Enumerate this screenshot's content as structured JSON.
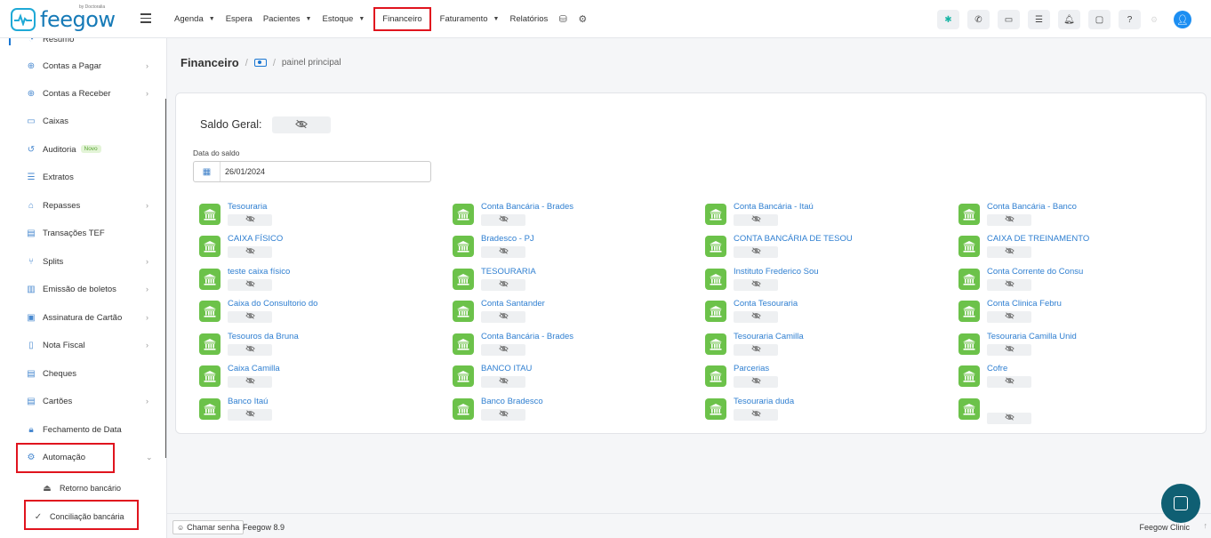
{
  "app": {
    "logo_text": "feegow",
    "logo_by": "by Doctoralia"
  },
  "nav": {
    "items": [
      {
        "label": "Agenda",
        "has_caret": true
      },
      {
        "label": "Espera",
        "has_caret": false
      },
      {
        "label": "Pacientes",
        "has_caret": true
      },
      {
        "label": "Estoque",
        "has_caret": true
      },
      {
        "label": "Financeiro",
        "has_caret": false,
        "highlighted": true
      },
      {
        "label": "Faturamento",
        "has_caret": true
      },
      {
        "label": "Relatórios",
        "has_caret": false
      }
    ],
    "extra_icons": [
      "database-icon",
      "gear-icon"
    ],
    "right_icons": [
      "star-icon",
      "phone-icon",
      "inbox-icon",
      "list-icon",
      "bell-icon",
      "chat-icon",
      "help-icon"
    ]
  },
  "sidebar": {
    "items": [
      {
        "label": "Resumo",
        "icon": "gauge-icon",
        "chevron": false
      },
      {
        "label": "Contas a Pagar",
        "icon": "arrow-up-circle-icon",
        "chevron": true
      },
      {
        "label": "Contas a Receber",
        "icon": "arrow-down-circle-icon",
        "chevron": true
      },
      {
        "label": "Caixas",
        "icon": "inbox-icon",
        "chevron": false
      },
      {
        "label": "Auditoria",
        "icon": "history-icon",
        "chevron": false,
        "badge": "Novo"
      },
      {
        "label": "Extratos",
        "icon": "list-icon",
        "chevron": false
      },
      {
        "label": "Repasses",
        "icon": "handshake-icon",
        "chevron": true
      },
      {
        "label": "Transações TEF",
        "icon": "card-icon",
        "chevron": false
      },
      {
        "label": "Splits",
        "icon": "split-icon",
        "chevron": true
      },
      {
        "label": "Emissão de boletos",
        "icon": "barcode-icon",
        "chevron": true
      },
      {
        "label": "Assinatura de Cartão",
        "icon": "id-card-icon",
        "chevron": true
      },
      {
        "label": "Nota Fiscal",
        "icon": "document-icon",
        "chevron": true
      },
      {
        "label": "Cheques",
        "icon": "cheque-icon",
        "chevron": false
      },
      {
        "label": "Cartões",
        "icon": "card-icon",
        "chevron": true
      },
      {
        "label": "Fechamento de Data",
        "icon": "lock-icon",
        "chevron": false
      },
      {
        "label": "Automação",
        "icon": "gears-icon",
        "chevron": true,
        "expanded": true
      }
    ],
    "subitems": [
      {
        "label": "Retorno bancário",
        "icon": "bank-return-icon"
      },
      {
        "label": "Conciliação bancária",
        "icon": "check-icon"
      }
    ]
  },
  "breadcrumb": {
    "title": "Financeiro",
    "sub": "painel principal"
  },
  "saldo": {
    "label": "Saldo Geral:",
    "date_label": "Data do saldo",
    "date_value": "26/01/2024"
  },
  "accounts": [
    [
      "Tesouraria",
      "Conta Bancária - Brades",
      "Conta Bancária - Itaú",
      "Conta Bancária - Banco"
    ],
    [
      "CAIXA FÍSICO",
      "Bradesco - PJ",
      "CONTA BANCÁRIA DE TESOU",
      "CAIXA DE TREINAMENTO"
    ],
    [
      "teste caixa físico",
      "TESOURARIA",
      "Instituto Frederico Sou",
      "Conta Corrente do Consu"
    ],
    [
      "Caixa do Consultorio do",
      "Conta Santander",
      "Conta Tesouraria",
      "Conta Clinica Febru"
    ],
    [
      "Tesouros da Bruna",
      "Conta Bancária - Brades",
      "Tesouraria Camilla",
      "Tesouraria Camilla Unid"
    ],
    [
      "Caixa Camilla",
      "BANCO ITAU",
      "Parcerias",
      "Cofre"
    ],
    [
      "Banco Itaú",
      "Banco Bradesco",
      "Tesouraria duda",
      ""
    ]
  ],
  "footer": {
    "chamar": "Chamar senha",
    "version": "Feegow 8.9",
    "clinic": "Feegow Clinic"
  },
  "colors": {
    "accent": "#1976d2",
    "bank_green": "#6cc24a",
    "link_blue": "#2f7fd1",
    "highlight_red": "#e0141e"
  }
}
